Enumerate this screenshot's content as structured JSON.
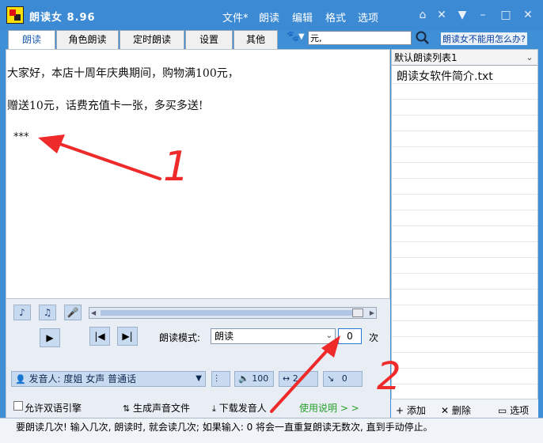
{
  "app": {
    "title": "朗读女 8.96"
  },
  "menu": [
    "文件*",
    "朗读",
    "编辑",
    "格式",
    "选项"
  ],
  "tabs": [
    {
      "label": "朗读",
      "active": true
    },
    {
      "label": "角色朗读"
    },
    {
      "label": "定时朗读"
    },
    {
      "label": "设置"
    },
    {
      "label": "其他"
    }
  ],
  "search": {
    "value": "元,"
  },
  "help_link": "朗读女不能用怎么办?",
  "editor": {
    "lines": [
      "大家好，本店十周年庆典期间，购物满100元，",
      "赠送10元，话费充值卡一张，多买多送!",
      "***"
    ]
  },
  "playlist": {
    "selected": "默认朗读列表1",
    "items": [
      "朗读女软件简介.txt"
    ],
    "add_label": "添加",
    "delete_label": "删除",
    "options_label": "选项"
  },
  "controls": {
    "mode_label": "朗读模式:",
    "mode_value": "朗读",
    "count_value": "0",
    "count_unit": "次",
    "speaker": "发音人: 度姐 女声 普通话",
    "volume": "100",
    "speed": "2",
    "pitch": "0",
    "bilingual_label": "允许双语引擎",
    "generate_audio_label": "生成声音文件",
    "download_label": "下载发音人",
    "usage_label": "使用说明 > >"
  },
  "status": "要朗读几次! 输入几次, 朗读时, 就会读几次; 如果输入: 0 将会一直重复朗读无数次, 直到手动停止。",
  "annotations": [
    "1",
    "2"
  ],
  "colors": {
    "title_bar": "#3c8ad3",
    "annotation": "#ee2a2a",
    "link": "#0a3e9e"
  }
}
